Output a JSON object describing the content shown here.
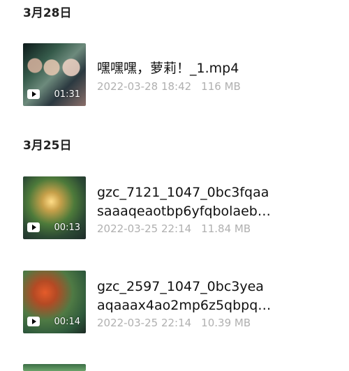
{
  "sections": [
    {
      "date": "3月28日",
      "items": [
        {
          "title_line1": "嘿嘿嘿，萝莉！_1.mp4",
          "title_line2": "",
          "duration": "01:31",
          "datetime": "2022-03-28 18:42",
          "size": "116 MB"
        }
      ]
    },
    {
      "date": "3月25日",
      "items": [
        {
          "title_line1": "gzc_7121_1047_0bc3fqaa",
          "title_line2": "saaaqeaotbp6yfqbolaeb…",
          "duration": "00:13",
          "datetime": "2022-03-25 22:14",
          "size": "11.84 MB"
        },
        {
          "title_line1": "gzc_2597_1047_0bc3yea",
          "title_line2": "aqaaax4ao2mp6z5qbpq…",
          "duration": "00:14",
          "datetime": "2022-03-25 22:14",
          "size": "10.39 MB"
        }
      ]
    }
  ]
}
